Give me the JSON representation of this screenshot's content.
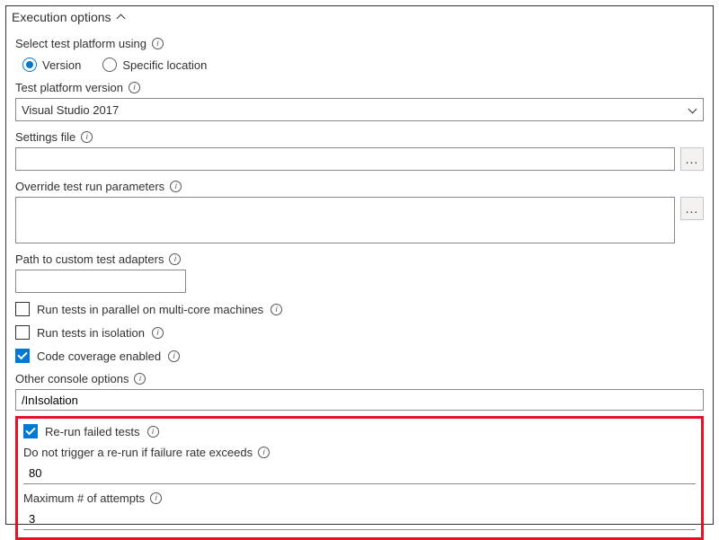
{
  "section": {
    "title": "Execution options"
  },
  "platform": {
    "label": "Select test platform using",
    "options": {
      "version": "Version",
      "specific": "Specific location"
    },
    "selected": "version"
  },
  "version": {
    "label": "Test platform version",
    "value": "Visual Studio 2017"
  },
  "settingsFile": {
    "label": "Settings file",
    "value": ""
  },
  "overrideParams": {
    "label": "Override test run parameters",
    "value": ""
  },
  "customAdapters": {
    "label": "Path to custom test adapters",
    "value": ""
  },
  "checkboxes": {
    "parallel": {
      "label": "Run tests in parallel on multi-core machines",
      "checked": false
    },
    "isolation": {
      "label": "Run tests in isolation",
      "checked": false
    },
    "coverage": {
      "label": "Code coverage enabled",
      "checked": true
    }
  },
  "otherConsole": {
    "label": "Other console options",
    "value": "/InIsolation"
  },
  "rerun": {
    "enable": {
      "label": "Re-run failed tests",
      "checked": true
    },
    "threshold": {
      "label": "Do not trigger a re-run if failure rate exceeds",
      "value": "80"
    },
    "attempts": {
      "label": "Maximum # of attempts",
      "value": "3"
    }
  },
  "icons": {
    "more": "..."
  }
}
